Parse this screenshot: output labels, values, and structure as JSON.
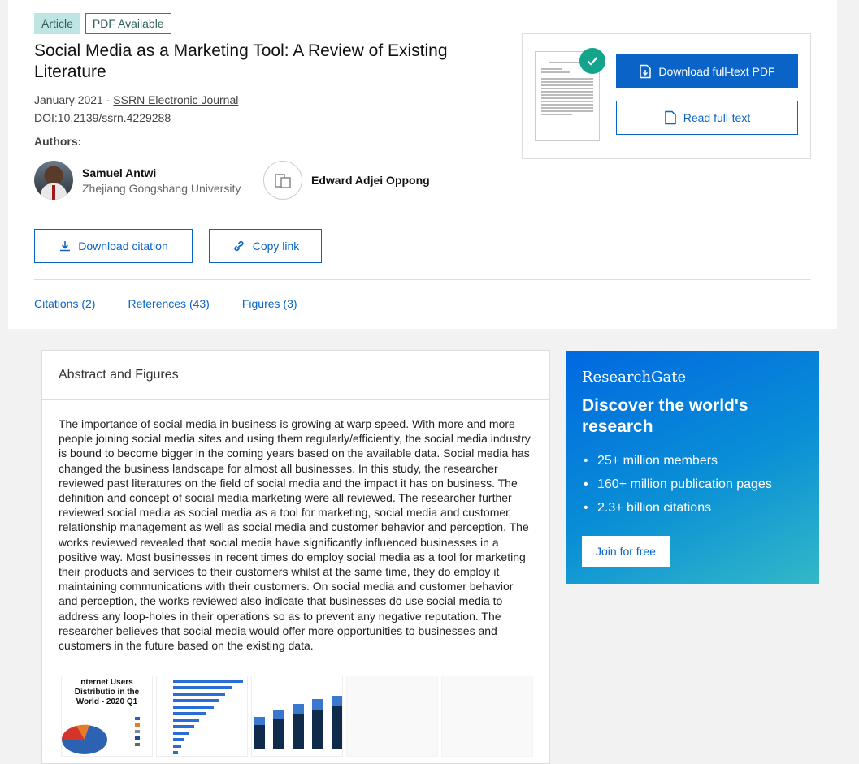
{
  "badges": {
    "article": "Article",
    "pdf": "PDF Available"
  },
  "title": "Social Media as a Marketing Tool: A Review of Existing Literature",
  "meta": {
    "date": "January 2021",
    "separator": " · ",
    "journal": "SSRN Electronic Journal",
    "doi_label": "DOI:",
    "doi": "10.2139/ssrn.4229288"
  },
  "authors_label": "Authors:",
  "authors": [
    {
      "name": "Samuel Antwi",
      "affiliation": "Zhejiang Gongshang University"
    },
    {
      "name": "Edward Adjei Oppong",
      "affiliation": ""
    }
  ],
  "actions": {
    "download_citation": "Download citation",
    "copy_link": "Copy link"
  },
  "tabs": [
    {
      "label": "Citations (2)"
    },
    {
      "label": "References (43)"
    },
    {
      "label": "Figures (3)"
    }
  ],
  "pdf_panel": {
    "download_label": "Download full-text PDF",
    "read_label": "Read full-text"
  },
  "abstract": {
    "heading": "Abstract and Figures",
    "text": "The importance of social media in business is growing at warp speed. With more and more people joining social media sites and using them regularly/efficiently, the social media industry is bound to become bigger in the coming years based on the available data. Social media has changed the business landscape for almost all businesses. In this study, the researcher reviewed past literatures on the field of social media and the impact it has on business. The definition and concept of social media marketing were all reviewed. The researcher further reviewed social media as social media as a tool for marketing, social media and customer relationship management as well as social media and customer behavior and perception. The works reviewed revealed that social media have significantly influenced businesses in a positive way. Most businesses in recent times do employ social media as a tool for marketing their products and services to their customers whilst at the same time, they do employ it maintaining communications with their customers. On social media and customer behavior and perception, the works reviewed also indicate that businesses do use social media to address any loop-holes in their operations so as to prevent any negative reputation. The researcher believes that social media would offer more opportunities to businesses and customers in the future based on the existing data.",
    "figure1_title": "nternet Users Distributio in the World - 2020 Q1"
  },
  "promo": {
    "logo": "ResearchGate",
    "headline": "Discover the world's research",
    "points": [
      "25+ million members",
      "160+ million publication pages",
      "2.3+ billion citations"
    ],
    "join_label": "Join for free"
  },
  "colors": {
    "accent": "#0a64c8",
    "badge_bg": "#bfe5e2",
    "check": "#14a38b"
  }
}
